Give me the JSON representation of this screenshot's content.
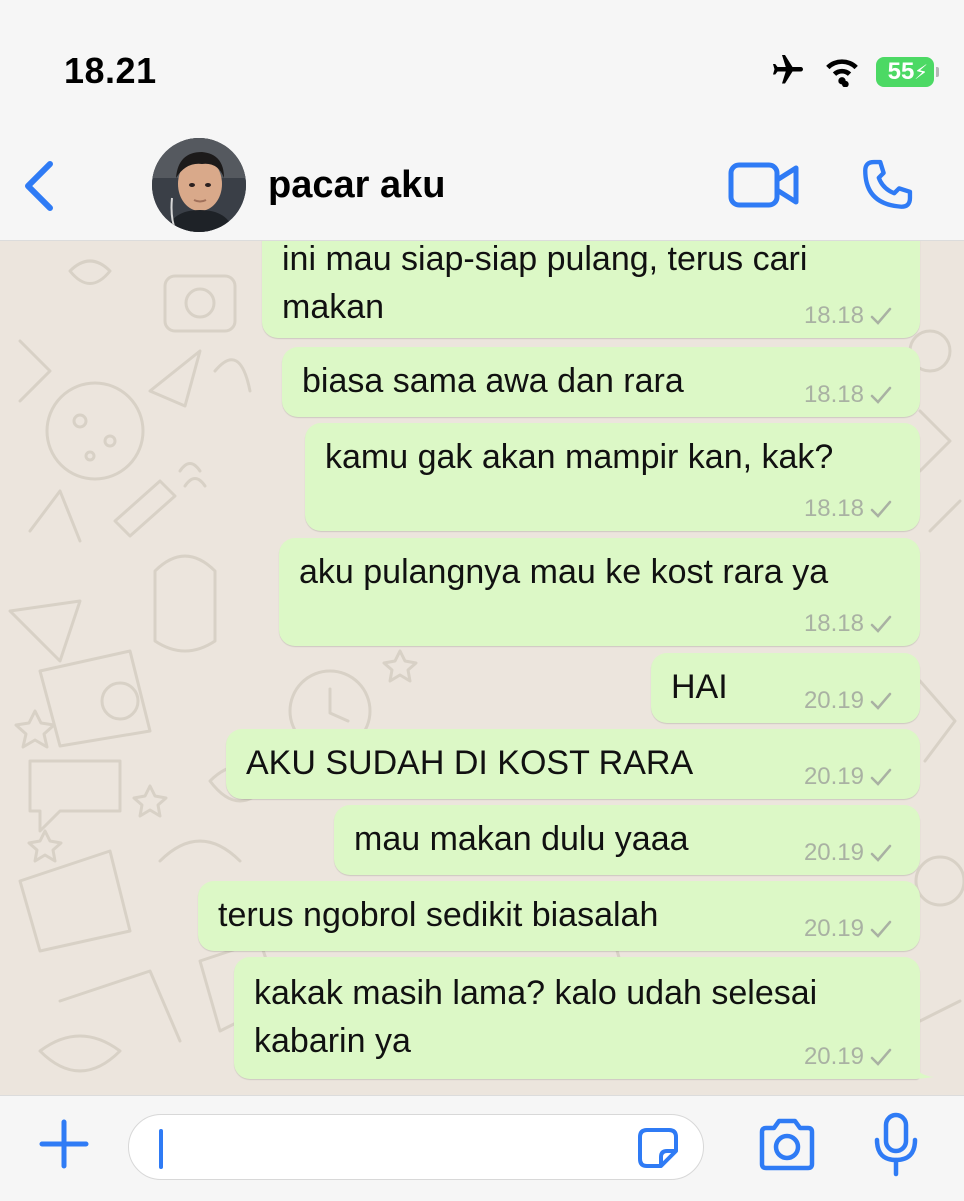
{
  "status_bar": {
    "time": "18.21",
    "battery_level": "55"
  },
  "header": {
    "contact_name": "pacar aku",
    "back_icon": "chevron-left-icon",
    "video_icon": "video-camera-icon",
    "call_icon": "phone-icon"
  },
  "messages": [
    {
      "text": "ini mau siap-siap pulang, terus cari\nmakan",
      "time": "18.18",
      "status": "sent"
    },
    {
      "text": "biasa sama awa dan rara",
      "time": "18.18",
      "status": "sent"
    },
    {
      "text": "kamu gak akan mampir kan, kak?",
      "time": "18.18",
      "status": "sent"
    },
    {
      "text": "aku pulangnya mau ke kost rara ya",
      "time": "18.18",
      "status": "sent"
    },
    {
      "text": "HAI",
      "time": "20.19",
      "status": "sent"
    },
    {
      "text": "AKU SUDAH DI KOST RARA",
      "time": "20.19",
      "status": "sent"
    },
    {
      "text": "mau makan dulu yaaa",
      "time": "20.19",
      "status": "sent"
    },
    {
      "text": "terus ngobrol sedikit biasalah",
      "time": "20.19",
      "status": "sent"
    },
    {
      "text": "kakak masih lama? kalo udah selesai\nkabarin ya",
      "time": "20.19",
      "status": "sent"
    }
  ],
  "input_bar": {
    "attach_icon": "plus-icon",
    "sticker_icon": "sticker-icon",
    "camera_icon": "camera-icon",
    "mic_icon": "microphone-icon",
    "input_value": ""
  },
  "colors": {
    "accent": "#2f7bf5",
    "bubble_outgoing": "#dcf8c6",
    "chat_background": "#ece5dd",
    "battery": "#4cd964",
    "timestamp": "#a9b1a3"
  }
}
